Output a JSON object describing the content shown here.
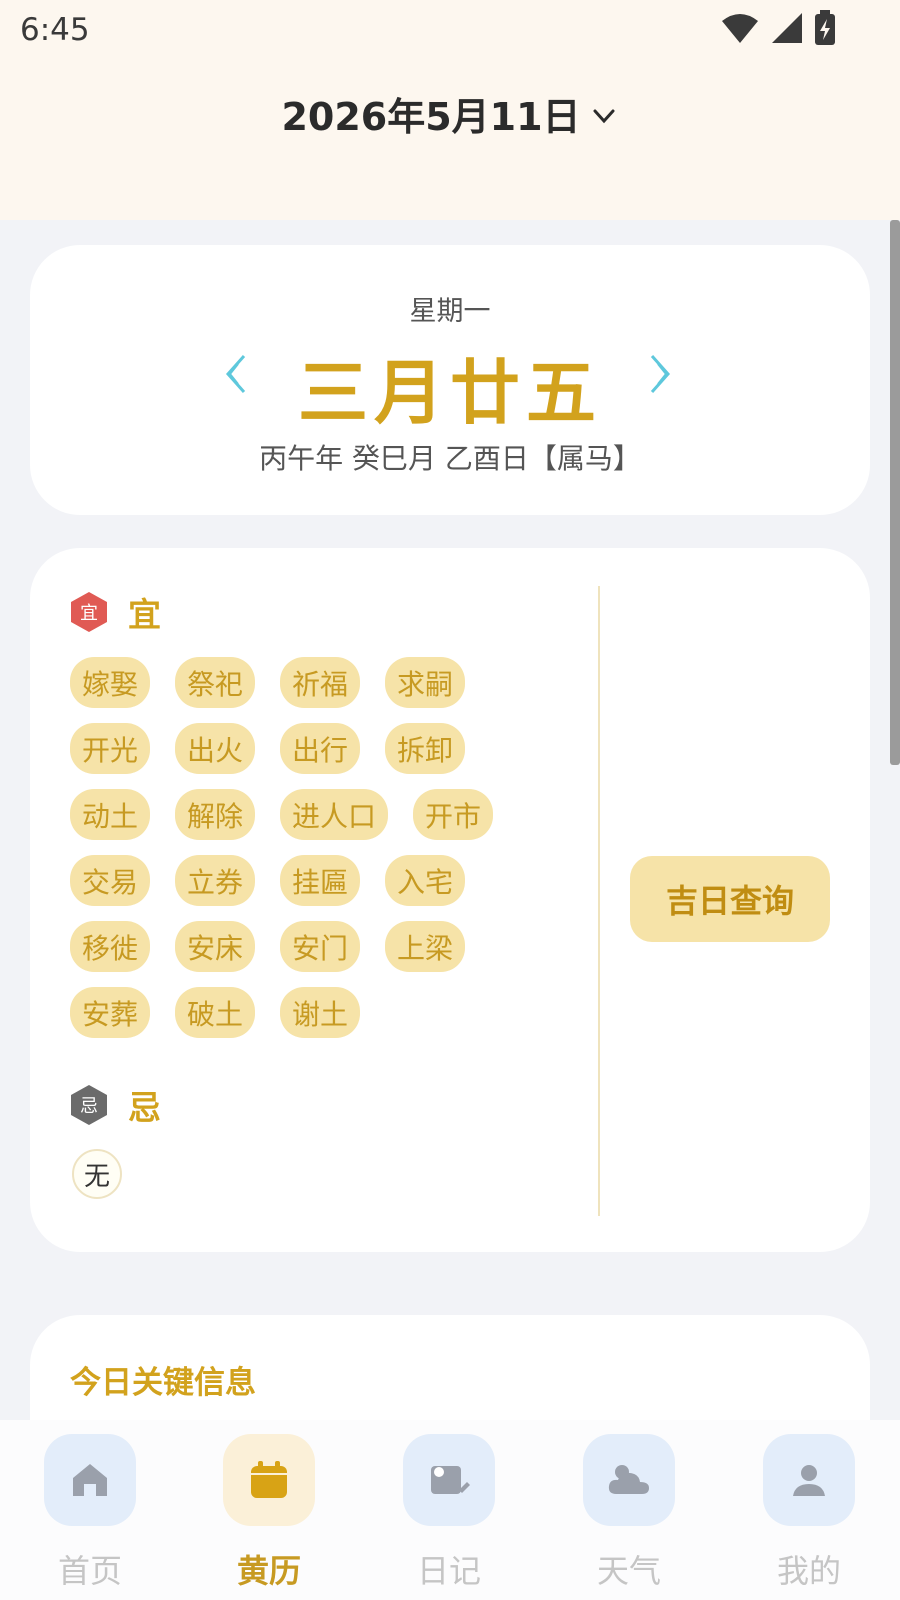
{
  "status_bar": {
    "time": "6:45"
  },
  "header": {
    "date": "2026年5月11日"
  },
  "lunar": {
    "weekday": "星期一",
    "date": "三月廿五",
    "ganzhi": "丙午年 癸巳月 乙酉日【属马】"
  },
  "yi": {
    "badge": "宜",
    "label": "宜",
    "rows": [
      [
        "嫁娶",
        "祭祀",
        "祈福",
        "求嗣"
      ],
      [
        "开光",
        "出火",
        "出行",
        "拆卸"
      ],
      [
        "动土",
        "解除",
        "进人口",
        "开市"
      ],
      [
        "交易",
        "立券",
        "挂匾",
        "入宅"
      ],
      [
        "移徙",
        "安床",
        "安门",
        "上梁"
      ],
      [
        "安葬",
        "破土",
        "谢土"
      ]
    ]
  },
  "ji": {
    "badge": "忌",
    "label": "忌",
    "items": [
      "无"
    ]
  },
  "lucky_day_button": "吉日查询",
  "key_info": {
    "title": "今日关键信息"
  },
  "tabs": [
    {
      "label": "首页",
      "icon": "home-icon"
    },
    {
      "label": "黄历",
      "icon": "calendar-icon"
    },
    {
      "label": "日记",
      "icon": "diary-icon"
    },
    {
      "label": "天气",
      "icon": "weather-icon"
    },
    {
      "label": "我的",
      "icon": "profile-icon"
    }
  ],
  "colors": {
    "accent": "#d2a21d",
    "tag_bg": "#f6e3a8",
    "header_bg": "#fdf7ef",
    "yi_badge": "#e05a54",
    "ji_badge": "#6b6b6b"
  }
}
